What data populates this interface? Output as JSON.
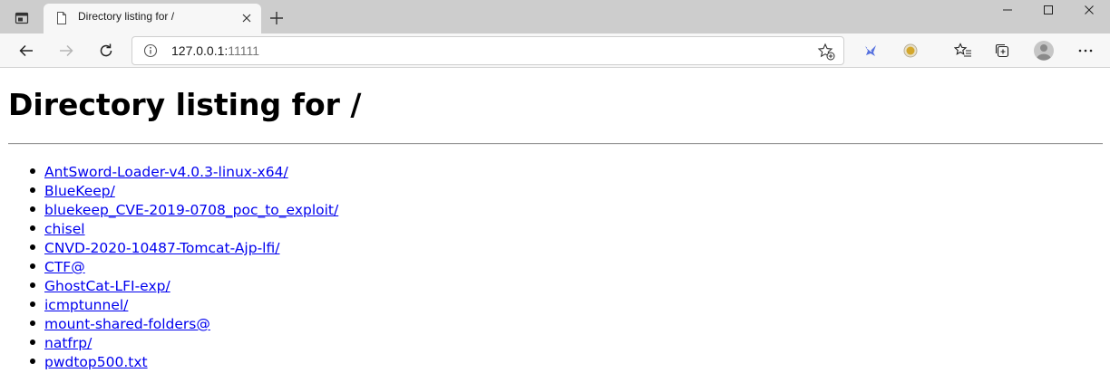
{
  "browser": {
    "tab": {
      "title": "Directory listing for /"
    },
    "address": {
      "host": "127.0.0.1:",
      "port": "11111"
    },
    "icons": {
      "tab_actions": "tab-actions-icon",
      "favicon": "page-icon",
      "close_tab": "close-icon",
      "new_tab": "plus-icon",
      "minimize": "minimize-icon",
      "maximize": "maximize-icon",
      "close_window": "close-icon",
      "back": "back-arrow-icon",
      "forward": "forward-arrow-icon",
      "refresh": "refresh-icon",
      "site_info": "info-icon",
      "add_favorite": "star-plus-icon",
      "extension_1": "bird-extension-icon",
      "extension_2": "circle-extension-icon",
      "favorites": "favorites-icon",
      "collections": "collections-icon",
      "profile": "profile-avatar-icon",
      "menu": "more-icon"
    }
  },
  "page": {
    "heading": "Directory listing for /",
    "entries": [
      "AntSword-Loader-v4.0.3-linux-x64/",
      "BlueKeep/",
      "bluekeep_CVE-2019-0708_poc_to_exploit/",
      "chisel",
      "CNVD-2020-10487-Tomcat-Ajp-lfi/",
      "CTF@",
      "GhostCat-LFI-exp/",
      "icmptunnel/",
      "mount-shared-folders@",
      "natfrp/",
      "pwdtop500.txt"
    ]
  },
  "colors": {
    "tabstrip": "#cdcdcd",
    "toolbar": "#f7f7f7",
    "link": "#0000ee",
    "extension_bird": "#3b5bdb",
    "extension_circle": "#d4a72c"
  }
}
